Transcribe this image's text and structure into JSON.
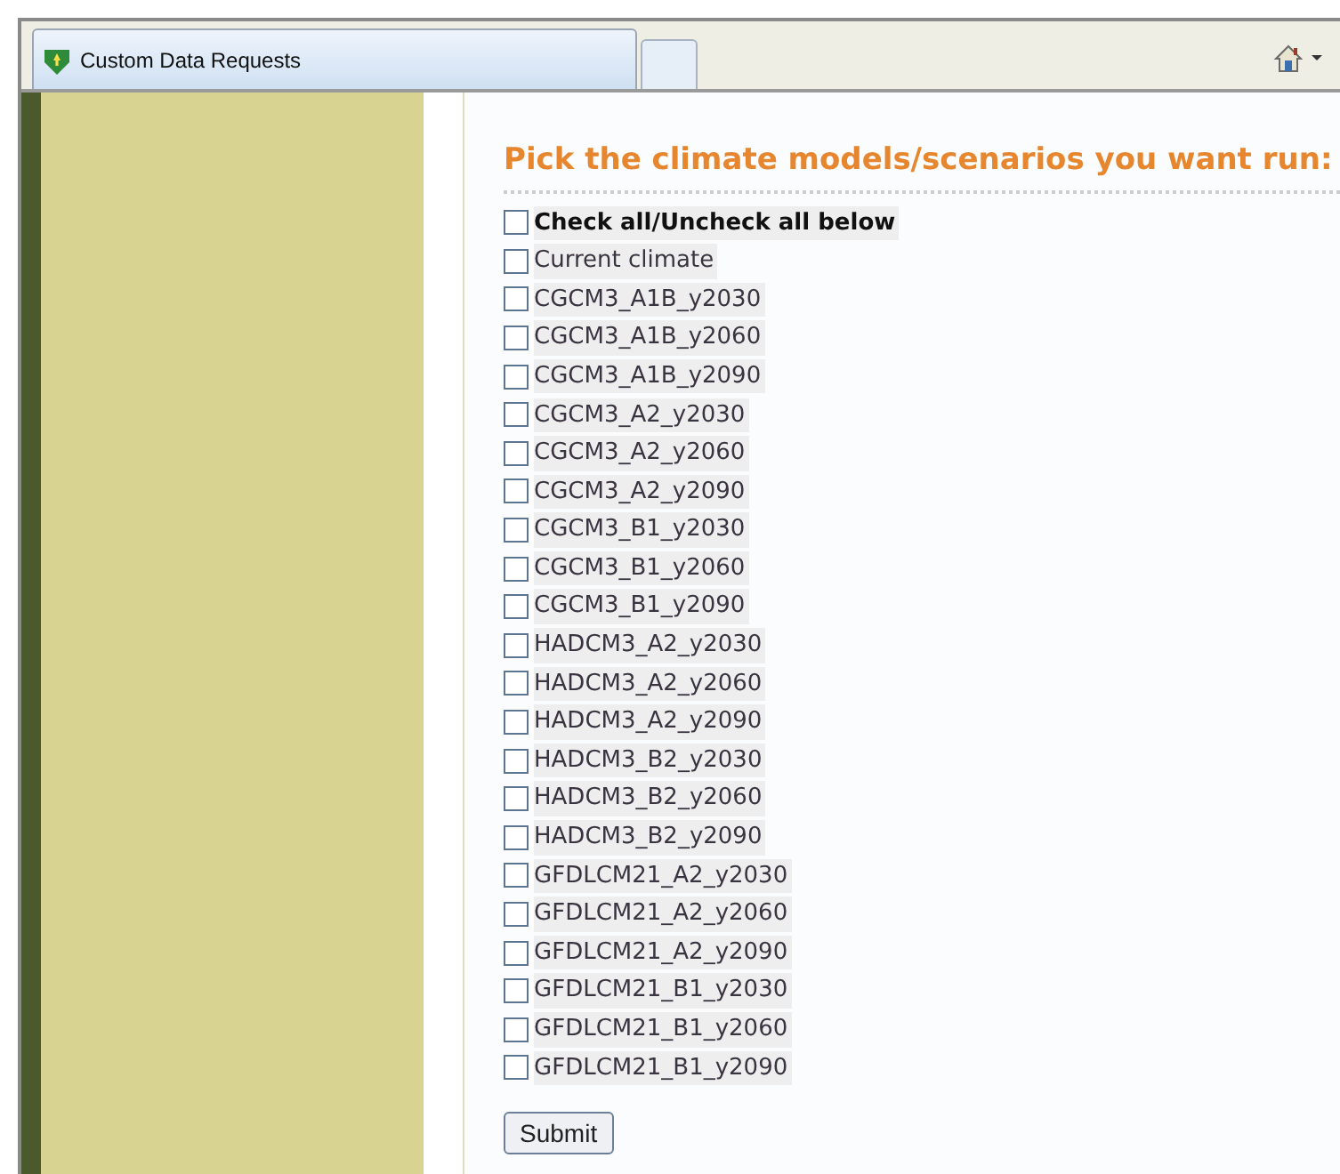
{
  "tabs": [
    {
      "label": "Custom Data Requests",
      "selected": true
    },
    {
      "selected": false
    }
  ],
  "heading": "Pick the climate models/scenarios you want run:",
  "options": [
    {
      "label": "Check all/Uncheck all below",
      "kind": "master",
      "checked": false
    },
    {
      "label": "Current climate",
      "kind": "option",
      "checked": false
    },
    {
      "label": "CGCM3_A1B_y2030",
      "kind": "option",
      "checked": false
    },
    {
      "label": "CGCM3_A1B_y2060",
      "kind": "option",
      "checked": false
    },
    {
      "label": "CGCM3_A1B_y2090",
      "kind": "option",
      "checked": false
    },
    {
      "label": "CGCM3_A2_y2030",
      "kind": "option",
      "checked": false
    },
    {
      "label": "CGCM3_A2_y2060",
      "kind": "option",
      "checked": false
    },
    {
      "label": "CGCM3_A2_y2090",
      "kind": "option",
      "checked": false
    },
    {
      "label": "CGCM3_B1_y2030",
      "kind": "option",
      "checked": false
    },
    {
      "label": "CGCM3_B1_y2060",
      "kind": "option",
      "checked": false
    },
    {
      "label": "CGCM3_B1_y2090",
      "kind": "option",
      "checked": false
    },
    {
      "label": "HADCM3_A2_y2030",
      "kind": "option",
      "checked": false
    },
    {
      "label": "HADCM3_A2_y2060",
      "kind": "option",
      "checked": false
    },
    {
      "label": "HADCM3_A2_y2090",
      "kind": "option",
      "checked": false
    },
    {
      "label": "HADCM3_B2_y2030",
      "kind": "option",
      "checked": false
    },
    {
      "label": "HADCM3_B2_y2060",
      "kind": "option",
      "checked": false
    },
    {
      "label": "HADCM3_B2_y2090",
      "kind": "option",
      "checked": false
    },
    {
      "label": "GFDLCM21_A2_y2030",
      "kind": "option",
      "checked": false
    },
    {
      "label": "GFDLCM21_A2_y2060",
      "kind": "option",
      "checked": false
    },
    {
      "label": "GFDLCM21_A2_y2090",
      "kind": "option",
      "checked": false
    },
    {
      "label": "GFDLCM21_B1_y2030",
      "kind": "option",
      "checked": false
    },
    {
      "label": "GFDLCM21_B1_y2060",
      "kind": "option",
      "checked": false
    },
    {
      "label": "GFDLCM21_B1_y2090",
      "kind": "option",
      "checked": false
    }
  ],
  "submit": "Submit"
}
